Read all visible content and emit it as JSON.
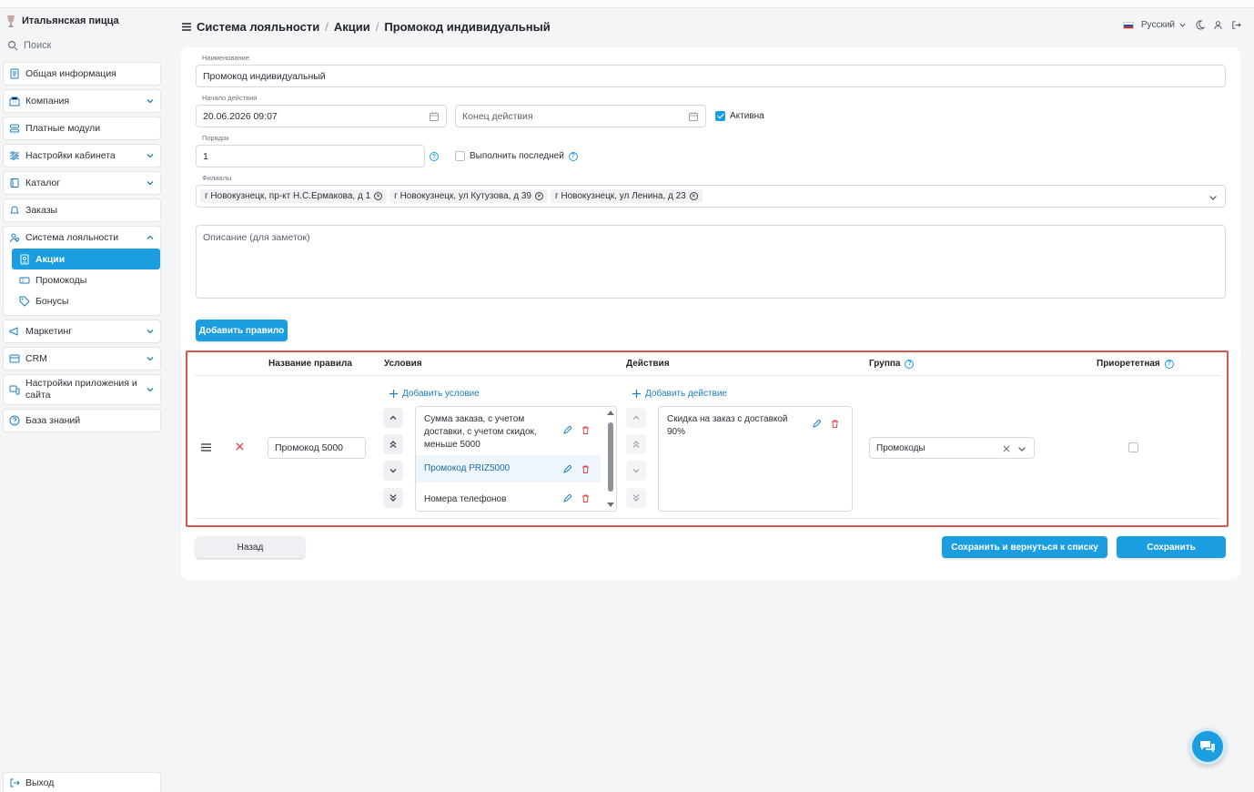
{
  "brand": {
    "name": "Итальянская пицца"
  },
  "sidebar": {
    "search_placeholder": "Поиск",
    "items": [
      {
        "label": "Общая информация",
        "icon": "document-icon"
      },
      {
        "label": "Компания",
        "icon": "building-icon"
      },
      {
        "label": "Платные модули",
        "icon": "stack-icon"
      },
      {
        "label": "Настройки кабинета",
        "icon": "sliders-icon"
      },
      {
        "label": "Каталог",
        "icon": "book-icon"
      },
      {
        "label": "Заказы",
        "icon": "bell-icon"
      }
    ],
    "loyalty": {
      "label": "Система лояльности",
      "subitems": [
        {
          "label": "Акции",
          "active": true
        },
        {
          "label": "Промокоды",
          "active": false
        },
        {
          "label": "Бонусы",
          "active": false
        }
      ]
    },
    "items2": [
      {
        "label": "Маркетинг"
      },
      {
        "label": "CRM"
      },
      {
        "label": "Настройки приложения и сайта"
      },
      {
        "label": "База знаний"
      }
    ],
    "logout": "Выход"
  },
  "header": {
    "breadcrumbs": [
      "Система лояльности",
      "Акции",
      "Промокод индивидуальный"
    ],
    "language": "Русский"
  },
  "form": {
    "name_label": "Наименование",
    "name_value": "Промокод индивидуальный",
    "start_label": "Начало действия",
    "start_value": "20.06.2026 09:07",
    "end_placeholder": "Конец действия",
    "active_label": "Активна",
    "order_label": "Порядок",
    "order_value": "1",
    "last_label": "Выполнить последней",
    "branches_label": "Филиалы",
    "branches": [
      "г Новокузнецк, пр-кт Н.С.Ермакова, д 1",
      "г Новокузнецк, ул Кутузова, д 39",
      "г Новокузнецк, ул Ленина, д 23"
    ],
    "description_placeholder": "Описание (для заметок)",
    "add_rule_button": "Добавить правило"
  },
  "rules": {
    "columns": {
      "name": "Название правила",
      "conditions": "Условия",
      "actions": "Действия",
      "group": "Группа",
      "priority": "Приорететная"
    },
    "row": {
      "name": "Промокод 5000",
      "add_condition": "Добавить условие",
      "conditions": [
        "Сумма заказа, с учетом доставки, с учетом скидок, меньше 5000",
        "Промокод PRIZ5000",
        "Номера телефонов"
      ],
      "add_action": "Добавить действие",
      "actions": [
        "Скидка на заказ с доставкой 90%"
      ],
      "group": "Промокоды"
    }
  },
  "footer": {
    "back": "Назад",
    "save_and_return": "Сохранить и вернуться к списку",
    "save": "Сохранить"
  },
  "colors": {
    "accent": "#1a9ee0",
    "highlight_border": "#d9534f",
    "delete": "#e0474c"
  }
}
